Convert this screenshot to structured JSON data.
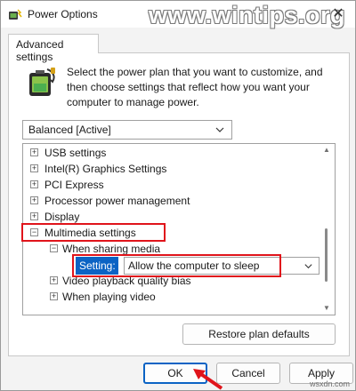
{
  "window": {
    "title": "Power Options",
    "watermark": "www.wintips.org",
    "close_glyph": "✕",
    "icons": {
      "app": "power-options-icon",
      "close": "close-icon"
    }
  },
  "tabs": [
    {
      "label": "Advanced settings",
      "active": true
    }
  ],
  "description": "Select the power plan that you want to customize, and then choose settings that reflect how you want your computer to manage power.",
  "plan_select": {
    "value": "Balanced [Active]",
    "icon": "chevron-down-icon"
  },
  "tree": {
    "items": [
      {
        "label": "USB settings",
        "expander": "+"
      },
      {
        "label": "Intel(R) Graphics Settings",
        "expander": "+"
      },
      {
        "label": "PCI Express",
        "expander": "+"
      },
      {
        "label": "Processor power management",
        "expander": "+"
      },
      {
        "label": "Display",
        "expander": "+"
      },
      {
        "label": "Multimedia settings",
        "expander": "−"
      },
      {
        "label": "When sharing media",
        "expander": "−"
      },
      {
        "label": "Video playback quality bias",
        "expander": "+"
      },
      {
        "label": "When playing video",
        "expander": "+"
      }
    ],
    "setting": {
      "label": "Setting:",
      "value": "Allow the computer to sleep",
      "icon": "chevron-down-icon"
    }
  },
  "highlight_color": "#e0141b",
  "accent_color": "#0b63c4",
  "buttons": {
    "restore": "Restore plan defaults",
    "ok": "OK",
    "cancel": "Cancel",
    "apply": "Apply"
  },
  "footer_mark": "wsxdn.com"
}
